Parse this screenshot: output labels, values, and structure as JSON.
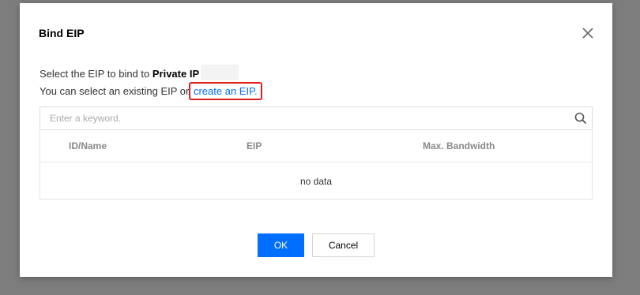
{
  "dialog": {
    "title": "Bind EIP",
    "line1_prefix": "Select the EIP to bind to ",
    "line1_bold": "Private IP",
    "line2_prefix": "You can select an existing EIP or ",
    "create_link": "create an EIP."
  },
  "search": {
    "placeholder": "Enter a keyword."
  },
  "table": {
    "columns": [
      "ID/Name",
      "EIP",
      "Max. Bandwidth"
    ],
    "empty_text": "no data"
  },
  "buttons": {
    "ok": "OK",
    "cancel": "Cancel"
  },
  "colors": {
    "primary": "#006eff",
    "highlight_border": "#e02020",
    "overlay": "#7d7d7d"
  }
}
